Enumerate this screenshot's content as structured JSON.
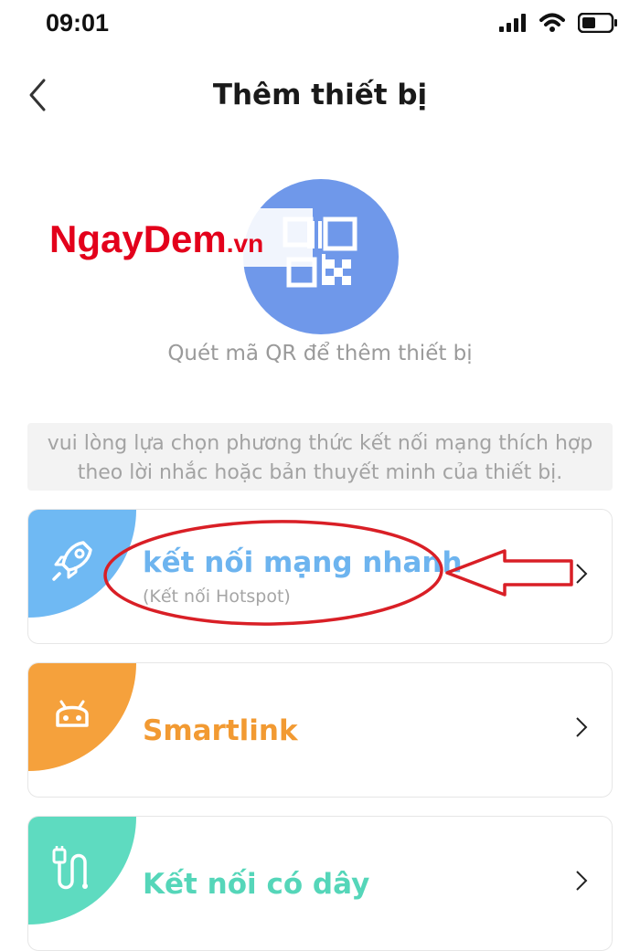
{
  "status_bar": {
    "time": "09:01"
  },
  "header": {
    "title": "Thêm thiết bị"
  },
  "watermark": {
    "brand": "NgayDem",
    "tld": ".vn"
  },
  "qr": {
    "caption": "Quét mã QR để thêm thiết bị"
  },
  "hint": {
    "text": "vui lòng lựa chọn phương thức kết nối mạng thích hợp theo lời nhắc hoặc bản thuyết minh của thiết bị."
  },
  "options": [
    {
      "label": "kết nối mạng nhanh",
      "sublabel": "(Kết nối Hotspot)",
      "icon": "rocket-icon",
      "color": "#6fb9f3"
    },
    {
      "label": "Smartlink",
      "icon": "android-icon",
      "color": "#f5a13c"
    },
    {
      "label": "Kết nối có dây",
      "icon": "cable-icon",
      "color": "#5edbc0"
    }
  ],
  "colors": {
    "qr_circle": "#6f98ea",
    "annotation": "#d91f26"
  }
}
